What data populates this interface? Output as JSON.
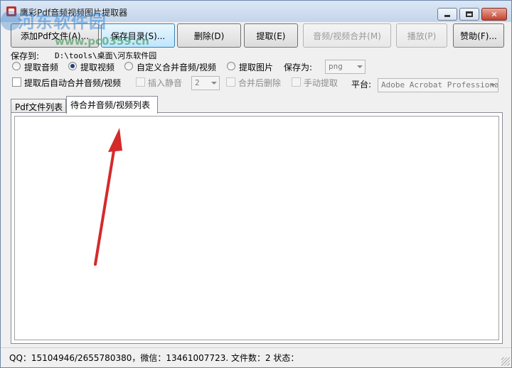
{
  "window": {
    "title": "鹰彩Pdf音频视频图片提取器"
  },
  "watermark": {
    "line1": "河东软件园",
    "line2": "www.pc0359.cn"
  },
  "toolbar": {
    "add_pdf": "添加Pdf文件(A)...",
    "save_dir": "保存目录(S)...",
    "delete": "删除(D)",
    "extract": "提取(E)",
    "merge": "音频/视频合并(M)",
    "play": "播放(P)",
    "sponsor": "赞助(F)..."
  },
  "save": {
    "label": "保存到:",
    "path": "D:\\tools\\桌面\\河东软件园"
  },
  "options": {
    "extract_audio": "提取音频",
    "extract_video": "提取视频",
    "custom_merge": "自定义合并音频/视频",
    "extract_image": "提取图片",
    "save_as_label": "保存为:",
    "save_as_value": "png",
    "auto_merge": "提取后自动合并音频/视频",
    "insert_silence": "插入静音",
    "silence_value": "2",
    "delete_after_merge": "合并后删除",
    "manual_extract": "手动提取",
    "platform_label": "平台:",
    "platform_value": "Adobe Acrobat Professional"
  },
  "tabs": [
    {
      "label": "Pdf文件列表"
    },
    {
      "label": "待合并音频/视频列表"
    }
  ],
  "status": {
    "text": "QQ：15104946/2655780380，微信：13461007723.  文件数：2  状态："
  },
  "colors": {
    "annotation_arrow": "#d42a2a",
    "titlebar": "#c4d5ea"
  }
}
